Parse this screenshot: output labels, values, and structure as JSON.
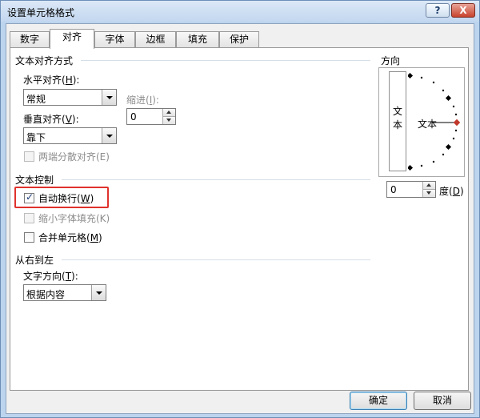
{
  "window": {
    "title": "设置单元格格式",
    "help_label": "?",
    "close_label": "X"
  },
  "tabs": [
    {
      "label": "数字",
      "active": false
    },
    {
      "label": "对齐",
      "active": true
    },
    {
      "label": "字体",
      "active": false
    },
    {
      "label": "边框",
      "active": false
    },
    {
      "label": "填充",
      "active": false
    },
    {
      "label": "保护",
      "active": false
    }
  ],
  "text_alignment": {
    "section_title": "文本对齐方式",
    "horizontal_label": "水平对齐(",
    "horizontal_key": "H",
    "horizontal_label_end": "):",
    "horizontal_value": "常规",
    "indent_label": "缩进(",
    "indent_key": "I",
    "indent_label_end": "):",
    "indent_value": "0",
    "vertical_label": "垂直对齐(",
    "vertical_key": "V",
    "vertical_label_end": "):",
    "vertical_value": "靠下",
    "distributed_label": "两端分散对齐(E)"
  },
  "text_control": {
    "section_title": "文本控制",
    "wrap_label": "自动换行(",
    "wrap_key": "W",
    "wrap_label_end": ")",
    "wrap_checked": true,
    "shrink_label": "缩小字体填充(K)",
    "merge_label": "合并单元格(",
    "merge_key": "M",
    "merge_label_end": ")"
  },
  "rtl": {
    "section_title": "从右到左",
    "direction_label": "文字方向(",
    "direction_key": "T",
    "direction_label_end": "):",
    "direction_value": "根据内容"
  },
  "orientation": {
    "section_title": "方向",
    "vertical_text": [
      "文",
      "本"
    ],
    "dial_text": "文本",
    "degree_value": "0",
    "degree_label": "度(",
    "degree_key": "D",
    "degree_label_end": ")"
  },
  "buttons": {
    "ok_label": "确定",
    "cancel_label": "取消"
  },
  "colors": {
    "highlight": "#e0322c",
    "dial_marker": "#c0392b"
  }
}
